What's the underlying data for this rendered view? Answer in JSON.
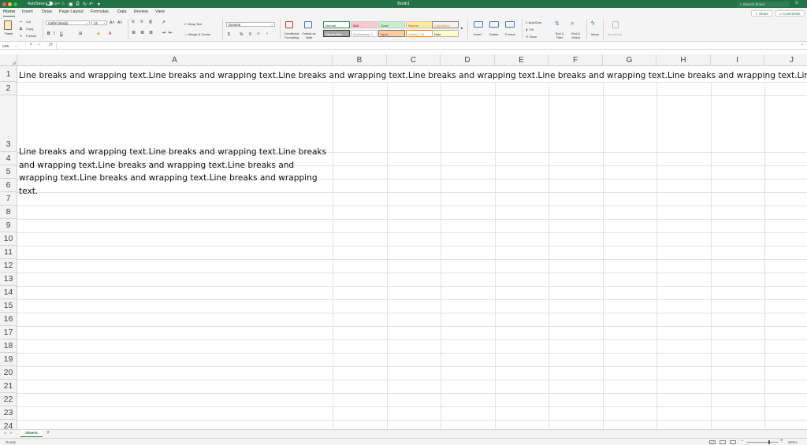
{
  "window": {
    "title": "Book1",
    "autosave_label": "AutoSave",
    "autosave_state": "OFF",
    "search_placeholder": "Search Sheet"
  },
  "ribbon_tabs": [
    "Home",
    "Insert",
    "Draw",
    "Page Layout",
    "Formulas",
    "Data",
    "Review",
    "View"
  ],
  "active_tab": "Home",
  "share_label": "Share",
  "comments_label": "Comments",
  "ribbon": {
    "paste": "Paste",
    "cut": "Cut",
    "copy": "Copy",
    "format": "Format",
    "font_name": "Calibri (Body)",
    "font_size": "12",
    "bold": "B",
    "italic": "I",
    "underline": "U",
    "wrap_text": "Wrap Text",
    "merge_center": "Merge & Center",
    "number_format": "General",
    "currency": "$",
    "percent": "%",
    "comma": "9",
    "conditional_formatting": "Conditional Formatting",
    "format_as_table": "Format as Table",
    "styles": {
      "normal": "Normal",
      "bad": "Bad",
      "good": "Good",
      "neutral": "Neutral",
      "calculation": "Calculation",
      "check_cell": "Check Cell",
      "explanatory": "Explanatory T...",
      "input": "Input",
      "linked_cell": "Linked Cell",
      "note": "Note"
    },
    "insert": "Insert",
    "delete": "Delete",
    "format_cells": "Format",
    "autosum": "AutoSum",
    "fill": "Fill",
    "clear": "Clear",
    "sort_filter": "Sort & Filter",
    "find_select": "Find & Select",
    "ideas": "Ideas",
    "sensitivity": "Sensitivity"
  },
  "formula_bar": {
    "name_box": "U55",
    "fx": "fx",
    "content": ""
  },
  "columns": [
    "A",
    "B",
    "C",
    "D",
    "E",
    "F",
    "G",
    "H",
    "I",
    "J"
  ],
  "rows": [
    "1",
    "2",
    "3",
    "4",
    "5",
    "6",
    "7",
    "8",
    "9",
    "10",
    "11",
    "12",
    "13",
    "14",
    "15",
    "16",
    "17",
    "18",
    "19",
    "20",
    "21",
    "22",
    "23",
    "24"
  ],
  "cells": {
    "A1": "Line breaks and wrapping text.Line breaks and wrapping text.Line breaks and wrapping text.Line breaks and wrapping text.Line breaks and wrapping text.Line breaks and wrapping text.Line breaks and wrapping text.",
    "A3": "Line breaks and wrapping text.Line breaks and wrapping text.Line breaks and wrapping text.Line breaks and wrapping text.Line breaks and wrapping text.Line breaks and wrapping text.Line breaks and wrapping text."
  },
  "sheet_tabs": [
    "Sheet1"
  ],
  "status": {
    "ready": "Ready",
    "zoom": "263%"
  },
  "colors": {
    "accent": "#217346"
  }
}
